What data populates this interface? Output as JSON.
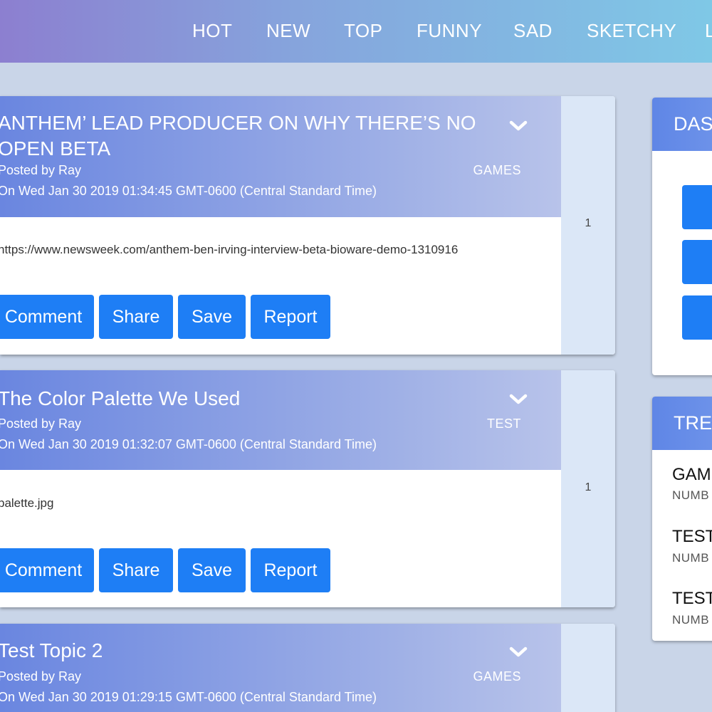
{
  "nav": {
    "items": [
      "HOT",
      "NEW",
      "TOP",
      "FUNNY",
      "SAD",
      "SKETCHY",
      "L"
    ]
  },
  "posts": [
    {
      "title": "ANTHEM’ LEAD PRODUCER ON WHY THERE’S NO OPEN BETA",
      "author": "Posted by Ray",
      "date": "On Wed Jan 30 2019 01:34:45 GMT-0600 (Central Standard Time)",
      "category": "GAMES",
      "votes": "1",
      "link": "https://www.newsweek.com/anthem-ben-irving-interview-beta-bioware-demo-1310916",
      "actions": [
        "Comment",
        "Share",
        "Save",
        "Report"
      ]
    },
    {
      "title": "The Color Palette We Used",
      "author": "Posted by Ray",
      "date": "On Wed Jan 30 2019 01:32:07 GMT-0600 (Central Standard Time)",
      "category": "TEST",
      "votes": "1",
      "link": "palette.jpg",
      "actions": [
        "Comment",
        "Share",
        "Save",
        "Report"
      ]
    },
    {
      "title": "Test Topic 2",
      "author": "Posted by Ray",
      "date": "On Wed Jan 30 2019 01:29:15 GMT-0600 (Central Standard Time)",
      "category": "GAMES"
    }
  ],
  "sidebar": {
    "dashboard_title": "DAS",
    "trending_title": "TRE",
    "trending": [
      {
        "name": "GAM",
        "sub": "NUMB"
      },
      {
        "name": "TEST",
        "sub": "NUMB"
      },
      {
        "name": "TEST",
        "sub": "NUMB"
      }
    ]
  },
  "colors": {
    "accent": "#1e7ef5",
    "nav_gradient_start": "#8c7fd0",
    "nav_gradient_end": "#7fc8e6",
    "page_background": "#c9d5e8"
  }
}
